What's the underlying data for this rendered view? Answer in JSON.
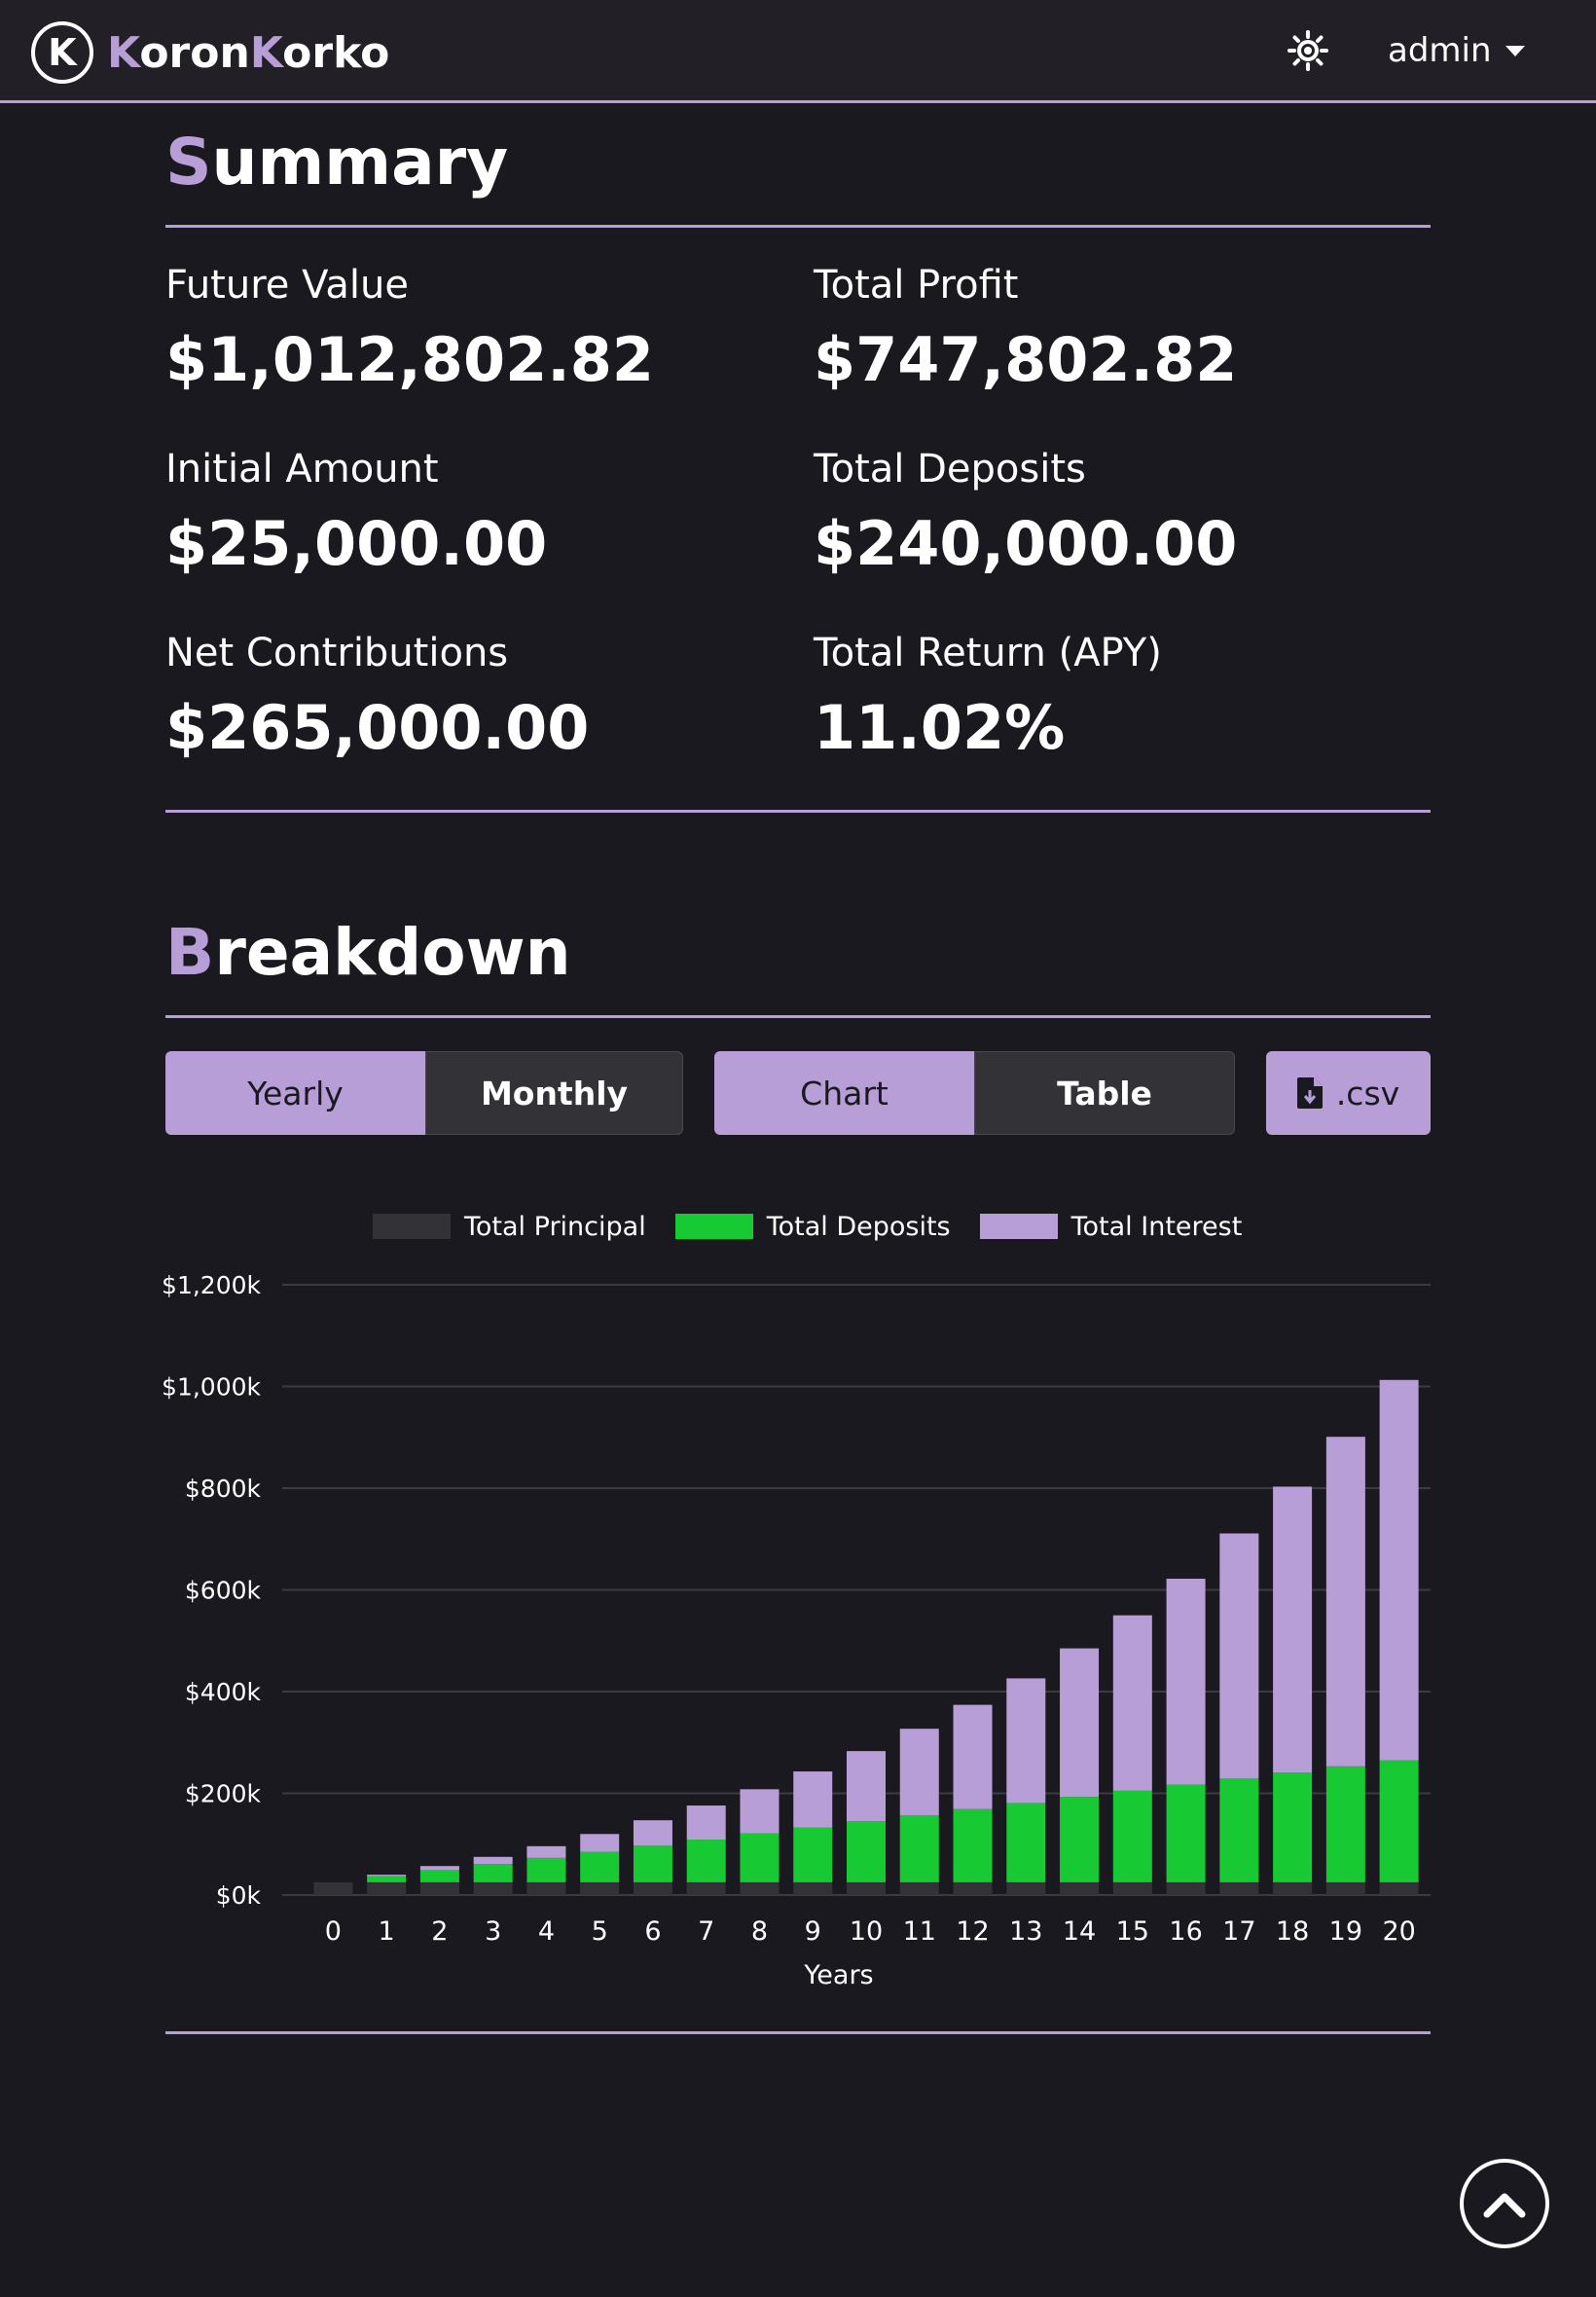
{
  "brand": {
    "name_part1": "Koron",
    "name_part2": "Korko",
    "name_initial1": "K",
    "name_rest1": "oron",
    "name_initial2": "K",
    "name_rest2": "orko",
    "logo_letter": "K"
  },
  "navbar": {
    "user": "admin"
  },
  "colors": {
    "accent": "#b89ed6",
    "deposits": "#17c933",
    "principal": "#333236",
    "background": "#1b1920"
  },
  "summary": {
    "title_initial": "S",
    "title_rest": "ummary",
    "stats": [
      {
        "label": "Future Value",
        "value": "$1,012,802.82"
      },
      {
        "label": "Total Profit",
        "value": "$747,802.82"
      },
      {
        "label": "Initial Amount",
        "value": "$25,000.00"
      },
      {
        "label": "Total Deposits",
        "value": "$240,000.00"
      },
      {
        "label": "Net Contributions",
        "value": "$265,000.00"
      },
      {
        "label": "Total Return (APY)",
        "value": "11.02%"
      }
    ]
  },
  "breakdown": {
    "title_initial": "B",
    "title_rest": "reakdown",
    "period_toggle": {
      "yearly": "Yearly",
      "monthly": "Monthly",
      "selected": "Yearly"
    },
    "view_toggle": {
      "chart": "Chart",
      "table": "Table",
      "selected": "Chart"
    },
    "csv_button": ".csv"
  },
  "chart_data": {
    "type": "bar",
    "stacked": true,
    "categories": [
      "0",
      "1",
      "2",
      "3",
      "4",
      "5",
      "6",
      "7",
      "8",
      "9",
      "10",
      "11",
      "12",
      "13",
      "14",
      "15",
      "16",
      "17",
      "18",
      "19",
      "20"
    ],
    "series": [
      {
        "name": "Total Principal",
        "values": [
          25000,
          25000,
          25000,
          25000,
          25000,
          25000,
          25000,
          25000,
          25000,
          25000,
          25000,
          25000,
          25000,
          25000,
          25000,
          25000,
          25000,
          25000,
          25000,
          25000,
          25000
        ]
      },
      {
        "name": "Total Deposits",
        "values": [
          0,
          12000,
          24000,
          36000,
          48000,
          60000,
          72000,
          84000,
          96000,
          108000,
          120000,
          132000,
          144000,
          156000,
          168000,
          180000,
          192000,
          204000,
          216000,
          228000,
          240000
        ]
      },
      {
        "name": "Total Interest",
        "values": [
          0,
          3000,
          8000,
          14000,
          23000,
          35000,
          50000,
          67000,
          87000,
          110000,
          138000,
          170000,
          205000,
          245000,
          292000,
          345000,
          405000,
          482000,
          562000,
          648000,
          747803
        ]
      }
    ],
    "xlabel": "Years",
    "ylabel": "",
    "ylim": [
      0,
      1200000
    ],
    "yticks": [
      "$0k",
      "$200k",
      "$400k",
      "$600k",
      "$800k",
      "$1,000k",
      "$1,200k"
    ],
    "ytick_values": [
      0,
      200000,
      400000,
      600000,
      800000,
      1000000,
      1200000
    ],
    "legend_position": "top-center",
    "grid": true
  }
}
